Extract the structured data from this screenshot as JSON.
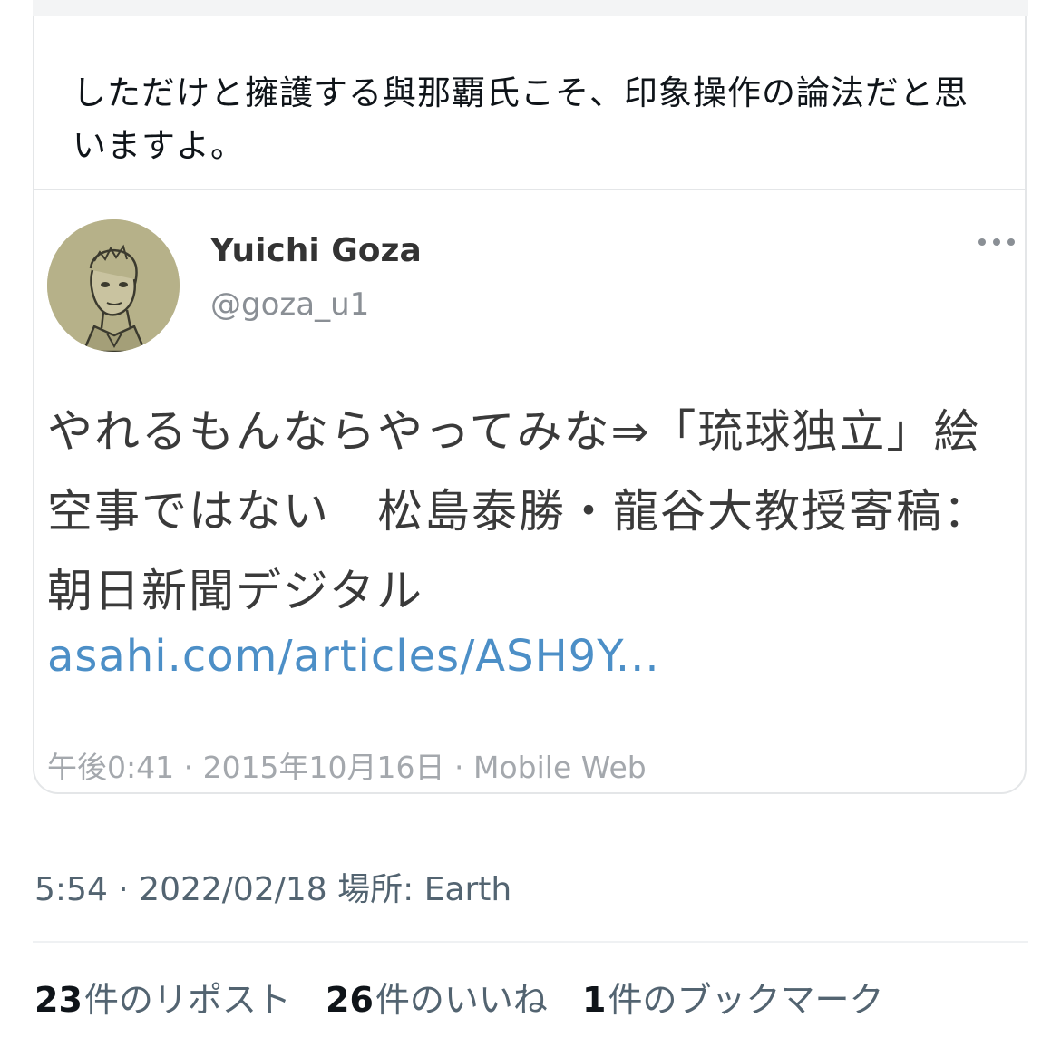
{
  "tweet": {
    "text": "しただけと擁護する與那覇氏こそ、印象操作の論法だと思いますよ。",
    "timestamp": "5:54 · 2022/02/18",
    "location_label": "場所: Earth"
  },
  "quoted_tweet": {
    "display_name": "Yuichi Goza",
    "handle": "@goza_u1",
    "body": "やれるもんならやってみな⇒「琉球独立」絵空事ではない　松島泰勝・龍谷大教授寄稿：朝日新聞デジタル",
    "link": "asahi.com/articles/ASH9Y...",
    "meta": "午後0:41 · 2015年10月16日 · Mobile Web",
    "more_icon": "more-horizontal-icon",
    "avatar": "illustrated-portrait-avatar"
  },
  "stats": {
    "reposts_count": "23",
    "reposts_label": "件のリポスト",
    "likes_count": "26",
    "likes_label": "件のいいね",
    "bookmarks_count": "1",
    "bookmarks_label": "件のブックマーク"
  },
  "colors": {
    "link": "#4c8fc7",
    "secondary_text": "#536471",
    "border": "#e4e6e8"
  }
}
